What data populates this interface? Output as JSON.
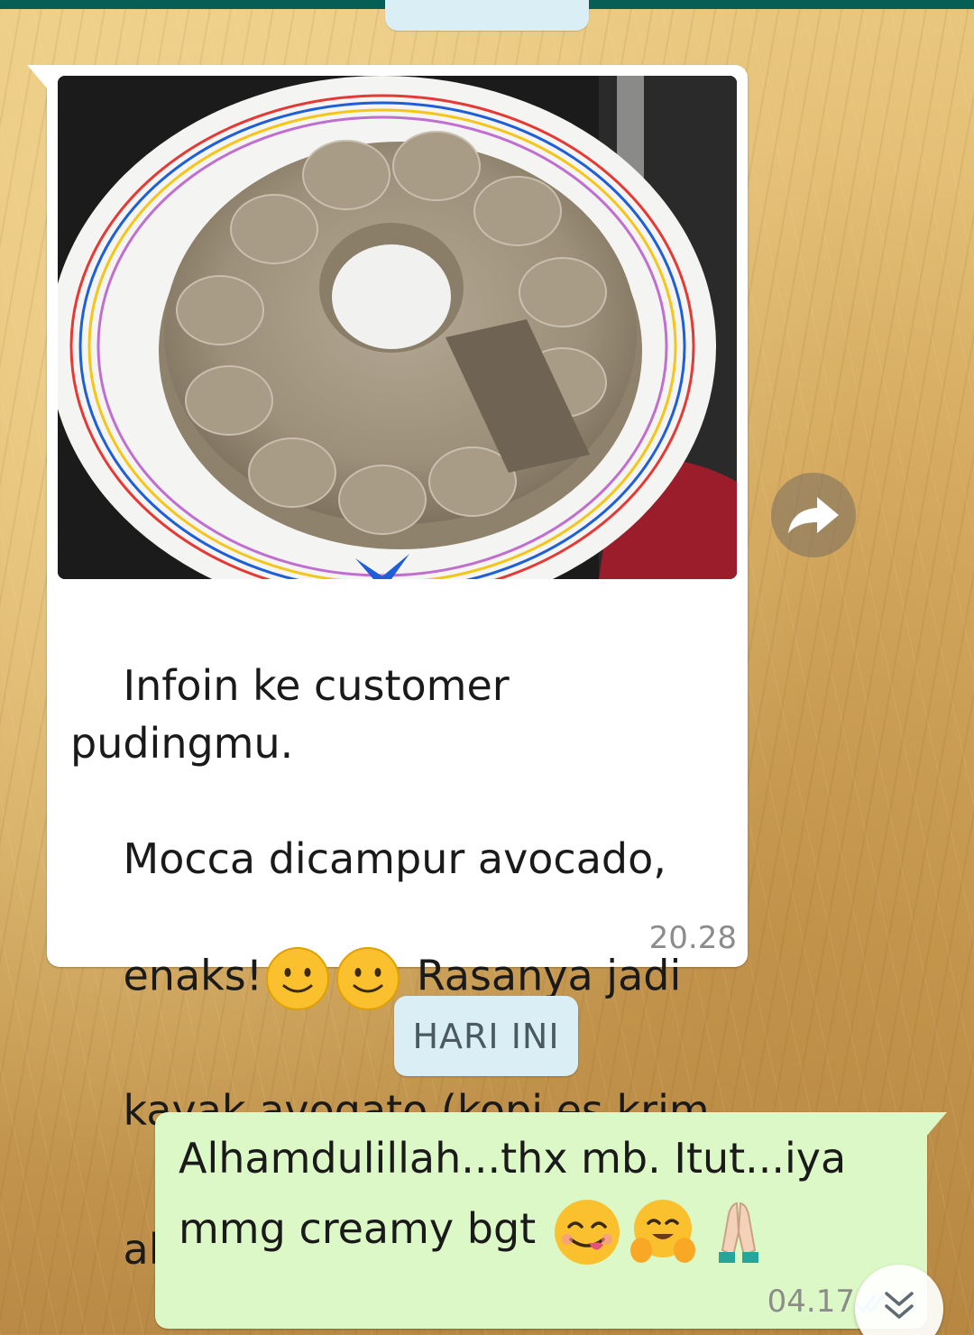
{
  "chat": {
    "previous_date_pill": "",
    "incoming_message": {
      "text_line1": "Infoin ke customer pudingmu.",
      "text_line2": "Mocca dicampur avocado,",
      "text_line3a": "enaks!",
      "text_line3b": " Rasanya jadi",
      "text_line4": "kayak avogato (kopi es krim",
      "text_line5": "alpukat).",
      "emojis": [
        "slightly-smiling-face",
        "slightly-smiling-face"
      ],
      "time": "20.28",
      "has_photo": true
    },
    "day_separator": "HARI INI",
    "outgoing_message": {
      "text_line1": "Alhamdulillah...thx mb. Itut...iya",
      "text_line2": "mmg creamy bgt ",
      "emojis": [
        "face-savoring-food",
        "hugging-face",
        "folded-hands"
      ],
      "time": "04.17",
      "status": "read-double-check"
    }
  },
  "colors": {
    "header": "#075e54",
    "incoming_bubble": "#ffffff",
    "outgoing_bubble": "#dcf8c6",
    "date_pill": "#d9eef5",
    "timestamp": "#8c8c8c",
    "read_ticks": "#4fc3f7"
  },
  "icons": {
    "forward": "forward-arrow-icon",
    "scroll_down": "double-chevron-down-icon"
  }
}
